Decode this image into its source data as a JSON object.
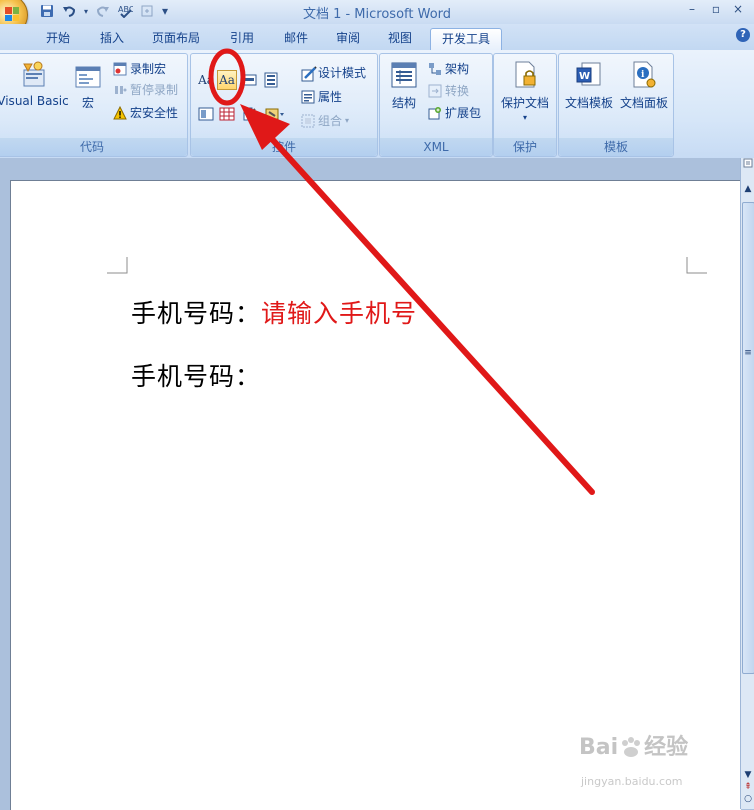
{
  "window": {
    "title": "文档 1 - Microsoft Word",
    "minimize": "–",
    "restore": "▫",
    "close": "×"
  },
  "quick_access": {
    "save_glyph": "💾",
    "undo_glyph": "↶",
    "redo_glyph": "↻",
    "customize_glyph": "▾"
  },
  "tabs": [
    {
      "label": "开始"
    },
    {
      "label": "插入"
    },
    {
      "label": "页面布局"
    },
    {
      "label": "引用"
    },
    {
      "label": "邮件"
    },
    {
      "label": "审阅"
    },
    {
      "label": "视图"
    },
    {
      "label": "开发工具"
    }
  ],
  "help_label": "?",
  "ribbon": {
    "code": {
      "label": "代码",
      "visual_basic": "Visual Basic",
      "macros": "宏",
      "record_macro": "录制宏",
      "pause_recording": "暂停录制",
      "macro_security": "宏安全性"
    },
    "controls": {
      "label": "控件",
      "rich_text_glyph": "Aa",
      "text_glyph": "Aa",
      "design_mode": "设计模式",
      "properties": "属性",
      "group": "组合"
    },
    "xml": {
      "label": "XML",
      "structure": "结构",
      "schema": "架构",
      "transform": "转换",
      "expansion_pack": "扩展包"
    },
    "protect": {
      "label": "保护",
      "protect_document": "保护文档"
    },
    "templates": {
      "label": "模板",
      "document_template": "文档模板",
      "document_panel": "文档面板"
    }
  },
  "document": {
    "line1_label": "手机号码：",
    "line1_placeholder": "请输入手机号",
    "line2_label": "手机号码："
  },
  "watermark": {
    "brand": "Bai",
    "brand2": "经验",
    "url": "jingyan.baidu.com"
  },
  "colors": {
    "annotation_red": "#e01818",
    "placeholder_red": "#e01818",
    "ribbon_text": "#15428b"
  }
}
